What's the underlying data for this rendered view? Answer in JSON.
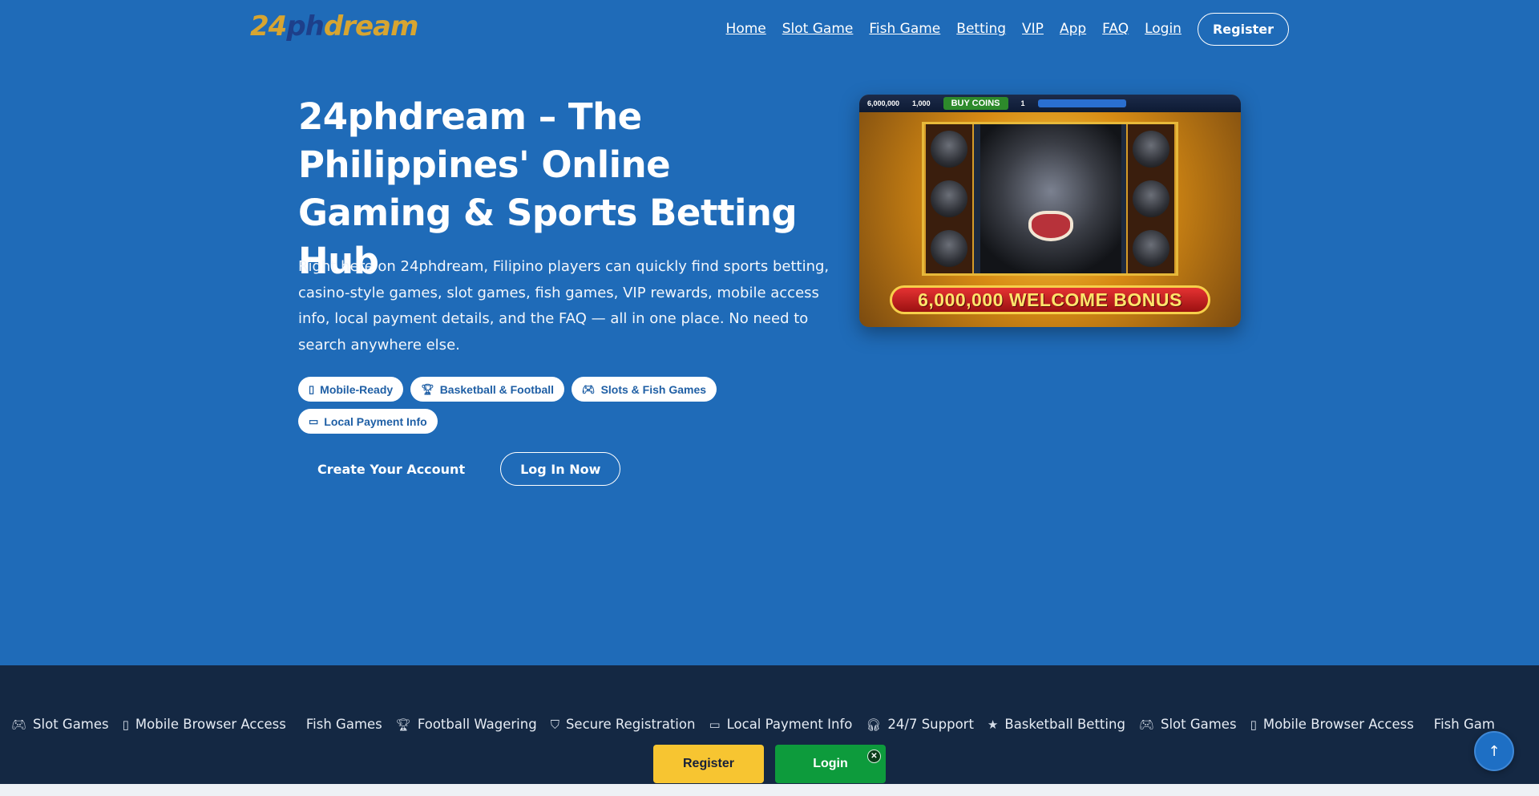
{
  "header": {
    "logo": {
      "num": "24",
      "ph": "ph",
      "dream": "dream"
    },
    "nav": [
      "Home",
      "Slot Game",
      "Fish Game",
      "Betting",
      "VIP",
      "App",
      "FAQ",
      "Login"
    ],
    "register_label": "Register"
  },
  "hero": {
    "title": "24phdream – The Philippines' Online Gaming & Sports Betting Hub",
    "description": "Right here on 24phdream, Filipino players can quickly find sports betting, casino-style games, slot games, fish games, VIP rewards, mobile access info, local payment details, and the FAQ — all in one place. No need to search anywhere else.",
    "chips": [
      {
        "icon": "mobile-icon",
        "glyph": "▯",
        "label": "Mobile-Ready"
      },
      {
        "icon": "trophy-icon",
        "glyph": "🏆︎",
        "label": "Basketball & Football"
      },
      {
        "icon": "gamepad-icon",
        "glyph": "🎮︎",
        "label": "Slots & Fish Games"
      },
      {
        "icon": "card-icon",
        "glyph": "▭",
        "label": "Local Payment Info"
      }
    ],
    "create_label": "Create Your Account",
    "login_label": "Log In Now"
  },
  "game_image": {
    "top_coins": "6,000,000",
    "top_gems": "1,000",
    "buy_coins": "BUY COINS",
    "level": "1",
    "banner": "6,000,000 WELCOME BONUS"
  },
  "ticker": [
    {
      "icon": "gamepad-icon",
      "glyph": "🎮︎",
      "label": "Slot Games"
    },
    {
      "icon": "mobile-icon",
      "glyph": "▯",
      "label": "Mobile Browser Access"
    },
    {
      "icon": "fish-icon",
      "glyph": "",
      "label": "Fish Games"
    },
    {
      "icon": "trophy-icon",
      "glyph": "🏆︎",
      "label": "Football Wagering"
    },
    {
      "icon": "shield-icon",
      "glyph": "⛉",
      "label": "Secure Registration"
    },
    {
      "icon": "card-icon",
      "glyph": "▭",
      "label": "Local Payment Info"
    },
    {
      "icon": "headset-icon",
      "glyph": "🎧︎",
      "label": "24/7 Support"
    },
    {
      "icon": "star-icon",
      "glyph": "★",
      "label": "Basketball Betting"
    },
    {
      "icon": "gamepad-icon",
      "glyph": "🎮︎",
      "label": "Slot Games"
    },
    {
      "icon": "mobile-icon",
      "glyph": "▯",
      "label": "Mobile Browser Access"
    },
    {
      "icon": "fish-icon",
      "glyph": "",
      "label": "Fish Gam"
    }
  ],
  "bottom_bar": {
    "register_label": "Register",
    "login_label": "Login",
    "close_glyph": "✕"
  },
  "scroll_top_glyph": "↑",
  "colors": {
    "background": "#1f6bb8",
    "ticker_bg": "#142843",
    "register_yellow": "#f7c531",
    "login_green": "#0d9b3c",
    "logo_gold": "#d7a531"
  }
}
